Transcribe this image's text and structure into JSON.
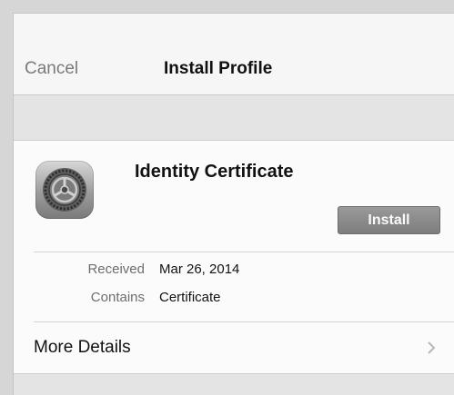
{
  "nav": {
    "cancel_label": "Cancel",
    "title": "Install Profile"
  },
  "profile": {
    "icon": "settings-gear-icon",
    "name": "Identity Certificate",
    "install_label": "Install",
    "details": [
      {
        "key": "Received",
        "value": "Mar 26, 2014"
      },
      {
        "key": "Contains",
        "value": "Certificate"
      }
    ],
    "more_details_label": "More Details",
    "more_details_icon": "chevron-right-icon"
  },
  "colors": {
    "install_button": "#8a8a8a",
    "background": "#efefef"
  }
}
